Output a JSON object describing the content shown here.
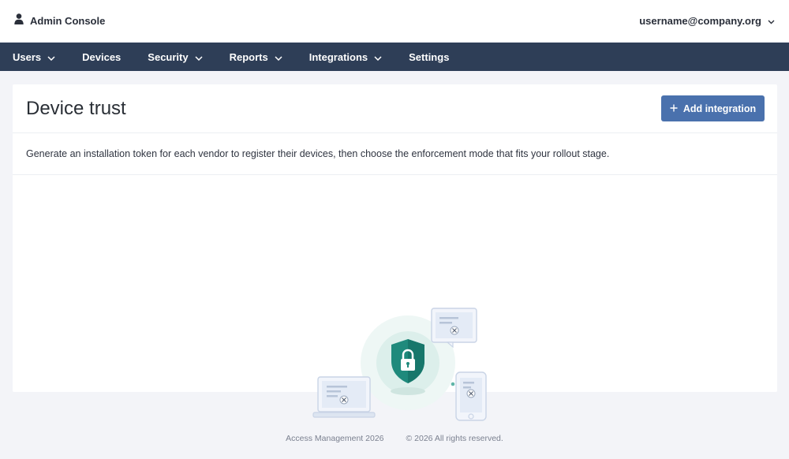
{
  "header": {
    "app_title": "Admin Console",
    "user_email": "username@company.org"
  },
  "nav": {
    "items": [
      {
        "label": "Users",
        "has_dropdown": true
      },
      {
        "label": "Devices",
        "has_dropdown": false
      },
      {
        "label": "Security",
        "has_dropdown": true
      },
      {
        "label": "Reports",
        "has_dropdown": true
      },
      {
        "label": "Integrations",
        "has_dropdown": true
      },
      {
        "label": "Settings",
        "has_dropdown": false
      }
    ]
  },
  "page": {
    "title": "Device trust",
    "add_button_label": "Add integration",
    "description": "Generate an installation token for each vendor to register their devices, then choose the enforcement mode that fits your rollout stage."
  },
  "footer": {
    "product": "Access Management 2026",
    "copyright": "© 2026 All rights reserved."
  },
  "colors": {
    "nav_bg": "#2e3e57",
    "primary_button": "#4a71ad",
    "shield": "#1f8a7c"
  }
}
